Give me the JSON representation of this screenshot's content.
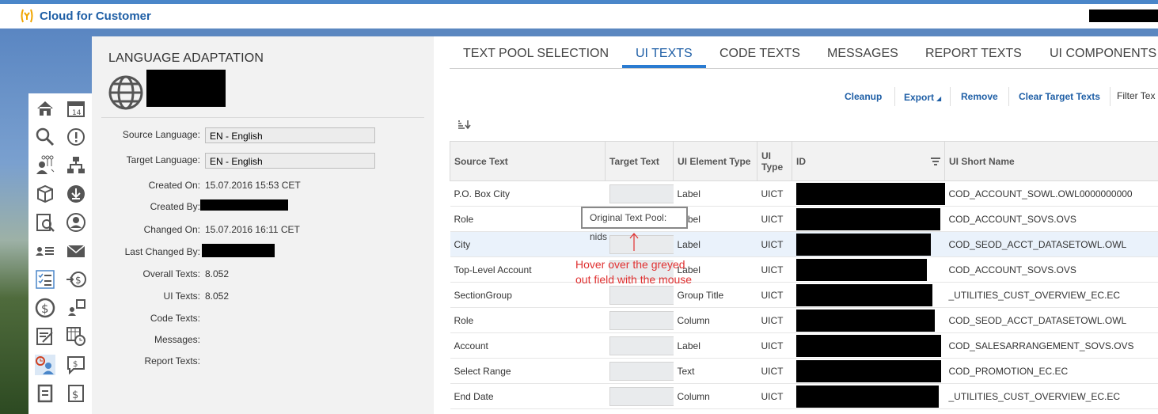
{
  "app": {
    "title": "Cloud for Customer"
  },
  "panel": {
    "title": "LANGUAGE ADAPTATION",
    "fields": [
      {
        "label": "Source Language:",
        "value": "EN - English",
        "kind": "input"
      },
      {
        "label": "Target Language:",
        "value": "EN - English",
        "kind": "input"
      },
      {
        "label": "Created On:",
        "value": "15.07.2016 15:53 CET",
        "kind": "text"
      },
      {
        "label": "Created By:",
        "value": "",
        "kind": "redacted"
      },
      {
        "label": "Changed On:",
        "value": "15.07.2016 16:11 CET",
        "kind": "text"
      },
      {
        "label": "Last Changed By:",
        "value": "",
        "kind": "redacted"
      },
      {
        "label": "Overall Texts:",
        "value": "8.052",
        "kind": "text"
      },
      {
        "label": "UI Texts:",
        "value": "8.052",
        "kind": "text"
      },
      {
        "label": "Code Texts:",
        "value": "",
        "kind": "text"
      },
      {
        "label": "Messages:",
        "value": "",
        "kind": "text"
      },
      {
        "label": "Report Texts:",
        "value": "",
        "kind": "text"
      }
    ]
  },
  "tabs": [
    "TEXT POOL SELECTION",
    "UI TEXTS",
    "CODE TEXTS",
    "MESSAGES",
    "REPORT TEXTS",
    "UI COMPONENTS"
  ],
  "active_tab": "UI TEXTS",
  "toolbar": {
    "cleanup": "Cleanup",
    "export": "Export",
    "remove": "Remove",
    "clear": "Clear Target Texts",
    "filter": "Filter Tex"
  },
  "table": {
    "headers": {
      "source": "Source Text",
      "target": "Target Text",
      "element": "UI Element Type",
      "uitype": "UI Type",
      "id": "ID",
      "short": "UI Short Name"
    },
    "rows": [
      {
        "source": "P.O. Box City",
        "element": "Label",
        "uitype": "UICT",
        "short": "COD_ACCOUNT_SOWL.OWL0000000000"
      },
      {
        "source": "Role",
        "element": "Label",
        "uitype": "UICT",
        "short": "COD_ACCOUNT_SOVS.OVS"
      },
      {
        "source": "City",
        "element": "Label",
        "uitype": "UICT",
        "short": "COD_SEOD_ACCT_DATASETOWL.OWL"
      },
      {
        "source": "Top-Level Account",
        "element": "Label",
        "uitype": "UICT",
        "short": "COD_ACCOUNT_SOVS.OVS"
      },
      {
        "source": "SectionGroup",
        "element": "Group Title",
        "uitype": "UICT",
        "short": "_UTILITIES_CUST_OVERVIEW_EC.EC"
      },
      {
        "source": "Role",
        "element": "Column",
        "uitype": "UICT",
        "short": "COD_SEOD_ACCT_DATASETOWL.OWL"
      },
      {
        "source": "Account",
        "element": "Label",
        "uitype": "UICT",
        "short": "COD_SALESARRANGEMENT_SOVS.OVS"
      },
      {
        "source": "Select Range",
        "element": "Text",
        "uitype": "UICT",
        "short": "COD_PROMOTION_EC.EC"
      },
      {
        "source": "End Date",
        "element": "Column",
        "uitype": "UICT",
        "short": "_UTILITIES_CUST_OVERVIEW_EC.EC"
      }
    ]
  },
  "tooltip": "Original Text Pool: nids",
  "annotation": "Hover over the greyed out field with the mouse",
  "colors": {
    "accent": "#1f5fa6",
    "annotation": "#e03030",
    "selected_row": "#eaf2fb"
  }
}
